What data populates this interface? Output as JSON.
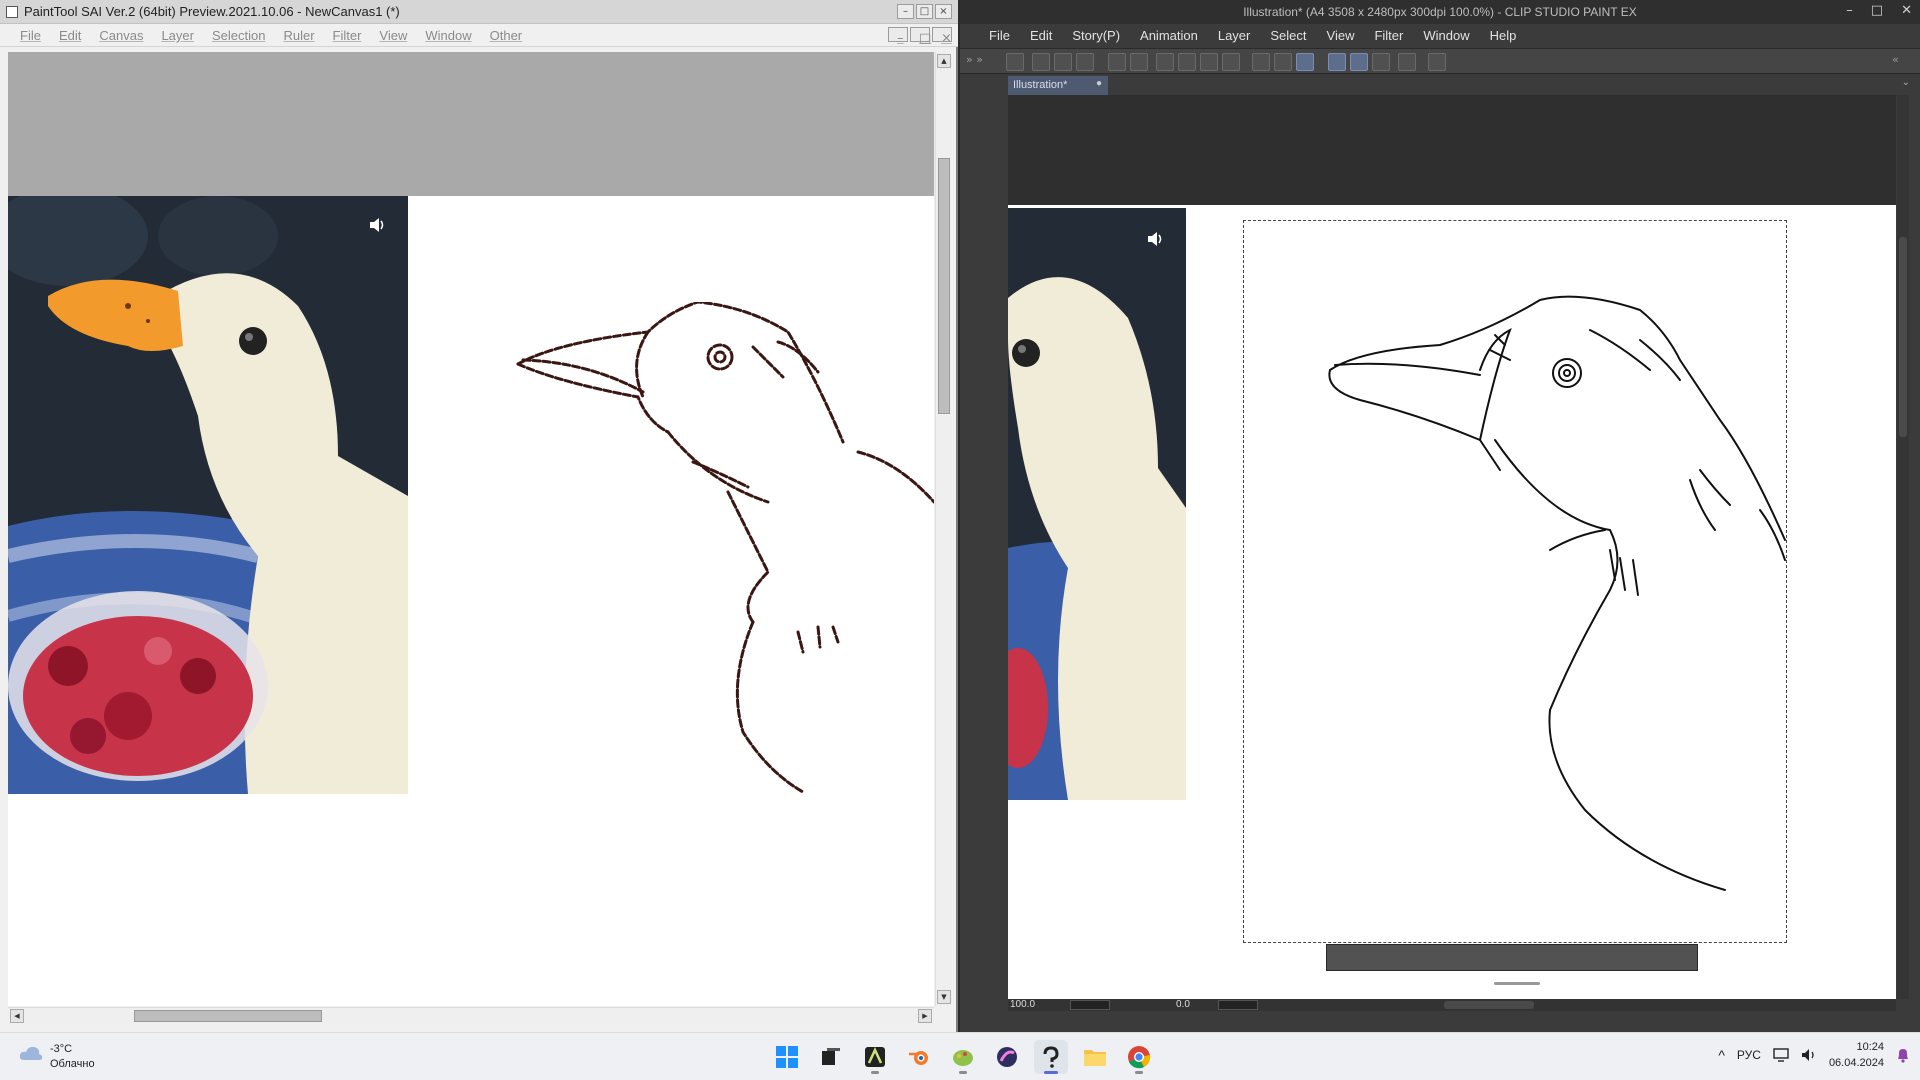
{
  "sai": {
    "title": "PaintTool SAI Ver.2 (64bit) Preview.2021.10.06 - NewCanvas1 (*)",
    "menu": [
      "File",
      "Edit",
      "Canvas",
      "Layer",
      "Selection",
      "Ruler",
      "Filter",
      "View",
      "Window",
      "Other"
    ],
    "window_buttons": [
      "–",
      "□",
      "×"
    ],
    "scroll_arrows": {
      "up": "▲",
      "down": "▼",
      "left": "◀",
      "right": "▶"
    }
  },
  "csp": {
    "title": "Illustration* (A4 3508 x 2480px 300dpi 100.0%)  - CLIP STUDIO PAINT EX",
    "window_controls": [
      "–",
      "□",
      "✕"
    ],
    "menu": [
      "File",
      "Edit",
      "Story(P)",
      "Animation",
      "Layer",
      "Select",
      "View",
      "Filter",
      "Window",
      "Help"
    ],
    "tab": {
      "label": "Illustration*",
      "close": "●"
    },
    "tab_dropdown": "⌄",
    "zoom": "100.0",
    "angle": "0.0",
    "panel_chevrons": "» »",
    "panel_chevrons_right": "«"
  },
  "taskbar": {
    "weather": {
      "temp": "-3°C",
      "desc": "Облачно"
    },
    "tray_chevron": "^",
    "language": "РУС",
    "time": "10:24",
    "date": "06.04.2024"
  },
  "colors": {
    "sai_line": "#3a1712",
    "csp_line": "#111111",
    "accent": "#5b6bd6"
  }
}
